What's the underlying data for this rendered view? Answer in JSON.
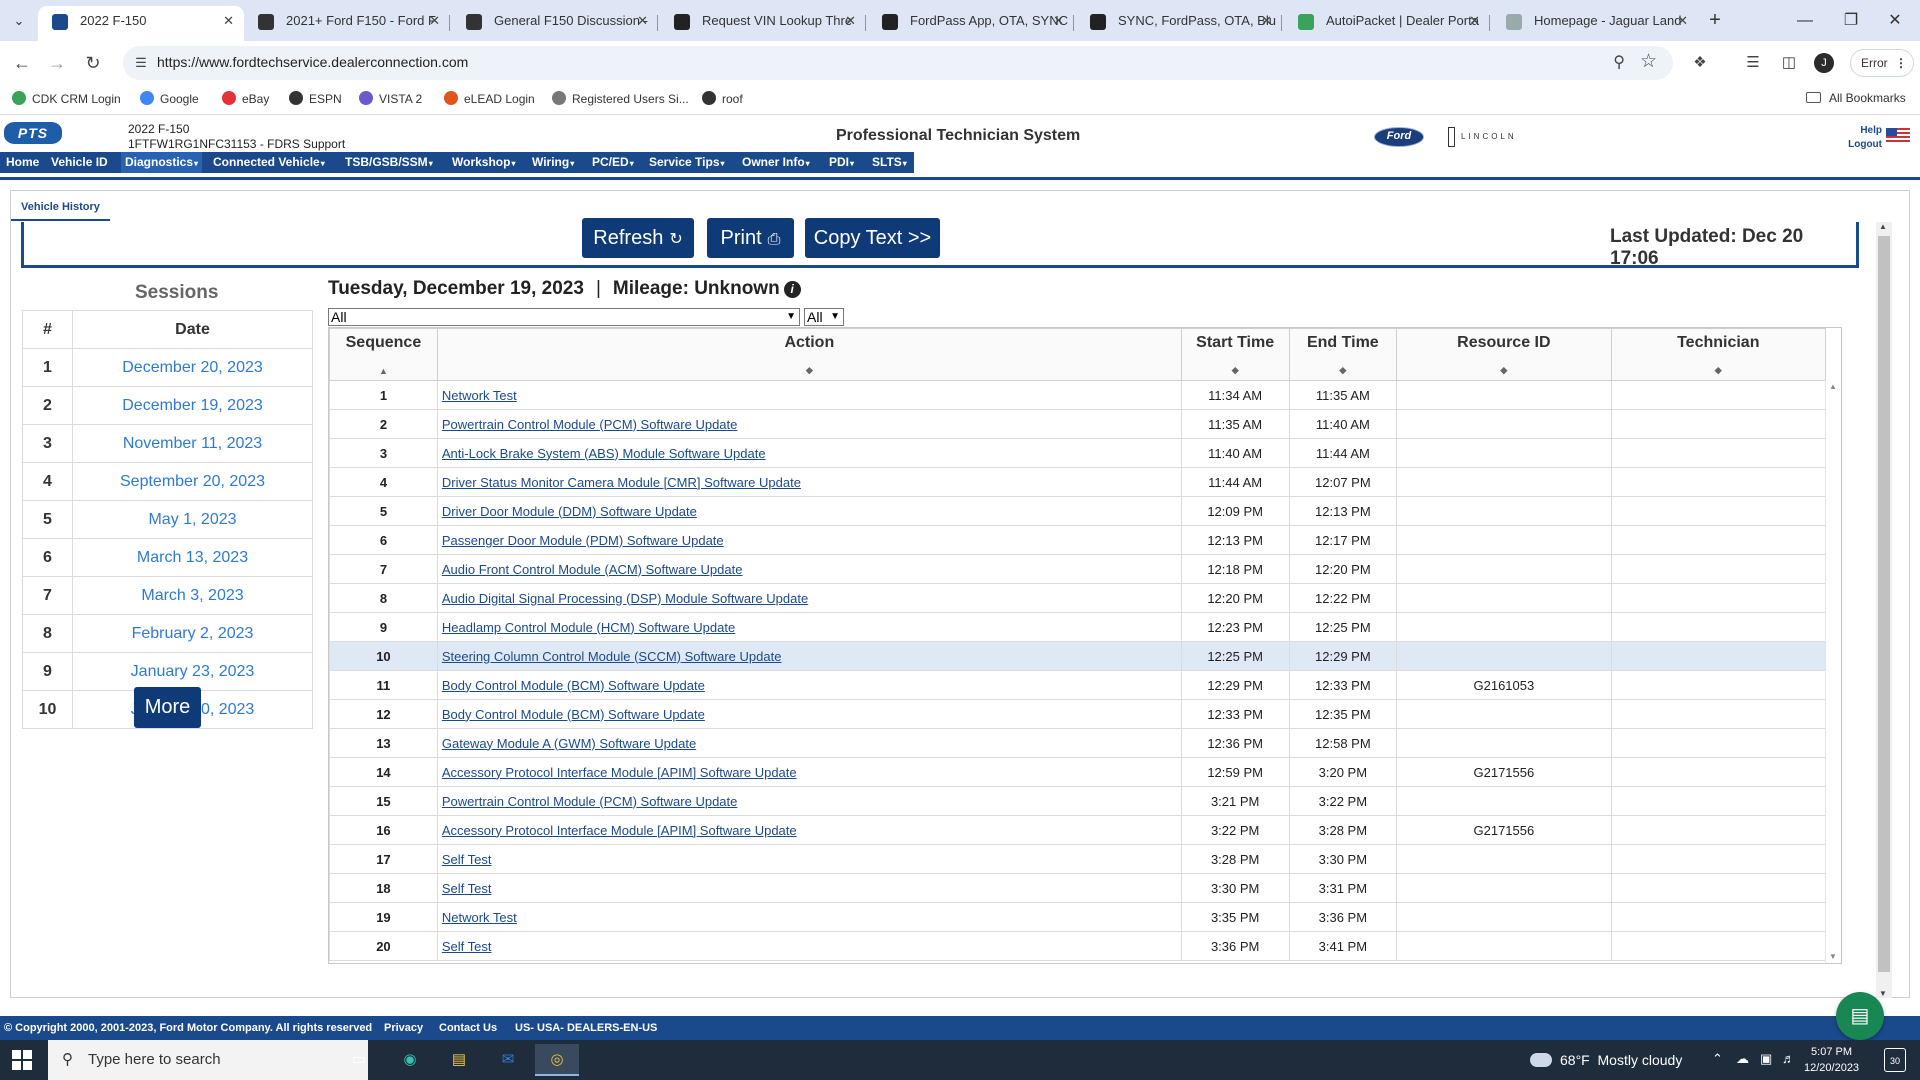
{
  "browser": {
    "tabs": [
      {
        "title": "2022 F-150",
        "active": true
      },
      {
        "title": "2021+ Ford F150 - Ford F"
      },
      {
        "title": "General F150 Discussion -"
      },
      {
        "title": "Request VIN Lookup Thre"
      },
      {
        "title": "FordPass App, OTA, SYNC"
      },
      {
        "title": "SYNC, FordPass, OTA, Blu"
      },
      {
        "title": "AutoiPacket | Dealer Porta"
      },
      {
        "title": "Homepage - Jaguar Land"
      }
    ],
    "url": "https://www.fordtechservice.dealerconnection.com",
    "profile_initial": "J",
    "error_label": "Error",
    "bookmarks": [
      {
        "label": "CDK CRM Login",
        "color": "#3aa35a",
        "icon": "cdk-icon"
      },
      {
        "label": "Google",
        "color": "#4285f4",
        "icon": "google-icon"
      },
      {
        "label": "eBay",
        "color": "#e53238",
        "icon": "ebay-icon"
      },
      {
        "label": "ESPN",
        "color": "#333333",
        "icon": "globe-icon"
      },
      {
        "label": "VISTA 2",
        "color": "#6a5acd",
        "icon": "vista-icon"
      },
      {
        "label": "eLEAD Login",
        "color": "#e2541b",
        "icon": "elead-icon"
      },
      {
        "label": "Registered Users Si...",
        "color": "#777777",
        "icon": "link-icon"
      },
      {
        "label": "roof",
        "color": "#333333",
        "icon": "globe-icon"
      }
    ],
    "all_bookmarks_label": "All Bookmarks"
  },
  "header": {
    "vehicle_model": "2022 F-150",
    "vin_line": "1FTFW1RG1NFC31153 - FDRS Support",
    "system_title": "Professional Technician System",
    "ford_logo": "Ford",
    "lincoln_logo": "LINCOLN",
    "help_label": "Help",
    "logout_label": "Logout"
  },
  "nav": {
    "items": [
      {
        "label": "Home",
        "has_menu": false
      },
      {
        "label": "Vehicle ID",
        "has_menu": false
      },
      {
        "label": "Diagnostics",
        "has_menu": true,
        "active": true
      },
      {
        "label": "Connected Vehicle",
        "has_menu": true
      },
      {
        "label": "TSB/GSB/SSM",
        "has_menu": true
      },
      {
        "label": "Workshop",
        "has_menu": true
      },
      {
        "label": "Wiring",
        "has_menu": true
      },
      {
        "label": "PC/ED",
        "has_menu": true
      },
      {
        "label": "Service Tips",
        "has_menu": true
      },
      {
        "label": "Owner Info",
        "has_menu": true
      },
      {
        "label": "PDI",
        "has_menu": true
      },
      {
        "label": "SLTS",
        "has_menu": true
      }
    ]
  },
  "page_tab": "Vehicle History",
  "toolbar": {
    "refresh_label": "Refresh",
    "print_label": "Print",
    "copy_label": "Copy Text >>",
    "last_updated": "Last Updated: Dec 20 17:06"
  },
  "sessions": {
    "title": "Sessions",
    "col_num": "#",
    "col_date": "Date",
    "rows": [
      {
        "num": "1",
        "date": "December 20, 2023"
      },
      {
        "num": "2",
        "date": "December 19, 2023"
      },
      {
        "num": "3",
        "date": "November 11, 2023"
      },
      {
        "num": "4",
        "date": "September 20, 2023"
      },
      {
        "num": "5",
        "date": "May 1, 2023"
      },
      {
        "num": "6",
        "date": "March 13, 2023"
      },
      {
        "num": "7",
        "date": "March 3, 2023"
      },
      {
        "num": "8",
        "date": "February 2, 2023"
      },
      {
        "num": "9",
        "date": "January 23, 2023"
      },
      {
        "num": "10",
        "date": "January 20, 2023"
      }
    ],
    "more_label": "More"
  },
  "detail": {
    "day": "Tuesday, December 19, 2023",
    "mileage": "Mileage: Unknown",
    "filter_action": "All",
    "filter_module": "All",
    "columns": {
      "sequence": "Sequence",
      "action": "Action",
      "start": "Start Time",
      "end": "End Time",
      "resource": "Resource ID",
      "technician": "Technician"
    },
    "highlighted_sequence": "10",
    "rows": [
      {
        "seq": "1",
        "action": "Network Test",
        "start": "11:34 AM",
        "end": "11:35 AM",
        "resource": "",
        "tech": ""
      },
      {
        "seq": "2",
        "action": "Powertrain Control Module (PCM) Software Update",
        "start": "11:35 AM",
        "end": "11:40 AM",
        "resource": "",
        "tech": ""
      },
      {
        "seq": "3",
        "action": "Anti-Lock Brake System (ABS) Module Software Update",
        "start": "11:40 AM",
        "end": "11:44 AM",
        "resource": "",
        "tech": ""
      },
      {
        "seq": "4",
        "action": "Driver Status Monitor Camera Module [CMR] Software Update",
        "start": "11:44 AM",
        "end": "12:07 PM",
        "resource": "",
        "tech": ""
      },
      {
        "seq": "5",
        "action": "Driver Door Module (DDM) Software Update",
        "start": "12:09 PM",
        "end": "12:13 PM",
        "resource": "",
        "tech": ""
      },
      {
        "seq": "6",
        "action": "Passenger Door Module (PDM) Software Update",
        "start": "12:13 PM",
        "end": "12:17 PM",
        "resource": "",
        "tech": ""
      },
      {
        "seq": "7",
        "action": "Audio Front Control Module (ACM) Software Update",
        "start": "12:18 PM",
        "end": "12:20 PM",
        "resource": "",
        "tech": ""
      },
      {
        "seq": "8",
        "action": "Audio Digital Signal Processing (DSP) Module Software Update",
        "start": "12:20 PM",
        "end": "12:22 PM",
        "resource": "",
        "tech": ""
      },
      {
        "seq": "9",
        "action": "Headlamp Control Module (HCM) Software Update",
        "start": "12:23 PM",
        "end": "12:25 PM",
        "resource": "",
        "tech": ""
      },
      {
        "seq": "10",
        "action": "Steering Column Control Module (SCCM) Software Update",
        "start": "12:25 PM",
        "end": "12:29 PM",
        "resource": "",
        "tech": ""
      },
      {
        "seq": "11",
        "action": "Body Control Module (BCM) Software Update",
        "start": "12:29 PM",
        "end": "12:33 PM",
        "resource": "G2161053",
        "tech": ""
      },
      {
        "seq": "12",
        "action": "Body Control Module (BCM) Software Update",
        "start": "12:33 PM",
        "end": "12:35 PM",
        "resource": "",
        "tech": ""
      },
      {
        "seq": "13",
        "action": "Gateway Module A (GWM) Software Update",
        "start": "12:36 PM",
        "end": "12:58 PM",
        "resource": "",
        "tech": ""
      },
      {
        "seq": "14",
        "action": "Accessory Protocol Interface Module [APIM] Software Update",
        "start": "12:59 PM",
        "end": "3:20 PM",
        "resource": "G2171556",
        "tech": ""
      },
      {
        "seq": "15",
        "action": "Powertrain Control Module (PCM) Software Update",
        "start": "3:21 PM",
        "end": "3:22 PM",
        "resource": "",
        "tech": ""
      },
      {
        "seq": "16",
        "action": "Accessory Protocol Interface Module [APIM] Software Update",
        "start": "3:22 PM",
        "end": "3:28 PM",
        "resource": "G2171556",
        "tech": ""
      },
      {
        "seq": "17",
        "action": "Self Test",
        "start": "3:28 PM",
        "end": "3:30 PM",
        "resource": "",
        "tech": ""
      },
      {
        "seq": "18",
        "action": "Self Test",
        "start": "3:30 PM",
        "end": "3:31 PM",
        "resource": "",
        "tech": ""
      },
      {
        "seq": "19",
        "action": "Network Test",
        "start": "3:35 PM",
        "end": "3:36 PM",
        "resource": "",
        "tech": ""
      },
      {
        "seq": "20",
        "action": "Self Test",
        "start": "3:36 PM",
        "end": "3:41 PM",
        "resource": "",
        "tech": ""
      }
    ]
  },
  "footer": {
    "copyright": "© Copyright 2000, 2001-2023, Ford Motor Company. All rights reserved",
    "privacy": "Privacy",
    "contact": "Contact Us",
    "locale": "US- USA- DEALERS-EN-US"
  },
  "taskbar": {
    "search_placeholder": "Type here to search",
    "weather_temp": "68°F",
    "weather_desc": "Mostly cloudy",
    "time": "5:07 PM",
    "date": "12/20/2023",
    "notification_count": "30"
  }
}
